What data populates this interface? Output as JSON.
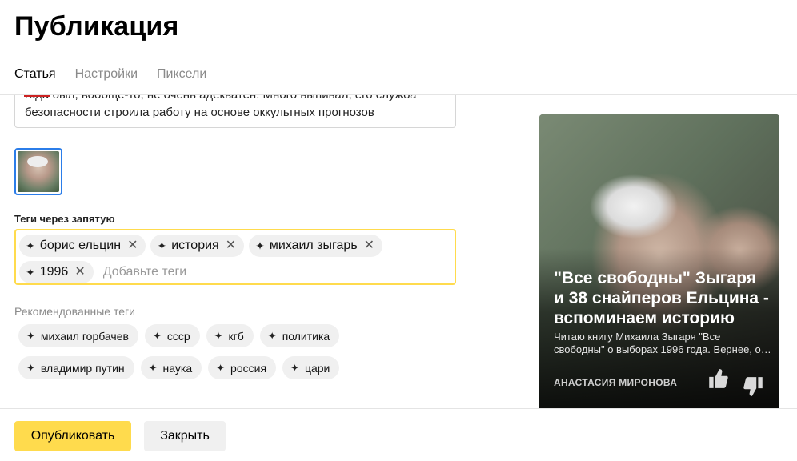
{
  "page": {
    "title": "Публикация"
  },
  "tabs": [
    {
      "label": "Статья",
      "active": true
    },
    {
      "label": "Настройки",
      "active": false
    },
    {
      "label": "Пиксели",
      "active": false
    }
  ],
  "article": {
    "text_line1": "года был, вообще-то, не очень адекватен. Много выпивал, его служба",
    "text_line2": "безопасности строила работу на основе оккультных прогнозов"
  },
  "tags": {
    "label": "Теги через запятую",
    "items": [
      "борис ельцин",
      "история",
      "михаил зыгарь",
      "1996"
    ],
    "placeholder": "Добавьте теги"
  },
  "recommended": {
    "label": "Рекомендованные теги",
    "row1": [
      "михаил горбачев",
      "ссср",
      "кгб",
      "политика"
    ],
    "row2": [
      "владимир путин",
      "наука",
      "россия",
      "цари"
    ]
  },
  "card": {
    "title": "\"Все свободны\" Зыгаря и 38 снайперов Ельцина - вспоминаем историю",
    "snippet": "Читаю книгу Михаила Зыгаря \"Все свободны\" о выборах 1996 года. Вернее, о…",
    "author": "АНАСТАСИЯ МИРОНОВА"
  },
  "footer": {
    "publish_label": "Опубликовать",
    "close_label": "Закрыть"
  },
  "colors": {
    "accent": "#ffdb4d",
    "selection_border": "#2b7de9",
    "chip_bg": "#f0f0f0"
  },
  "icons": {
    "tag_icon": "sparkle-icon",
    "remove_icon": "close-icon",
    "like_icon": "thumbs-up-icon",
    "dislike_icon": "thumbs-down-icon"
  }
}
